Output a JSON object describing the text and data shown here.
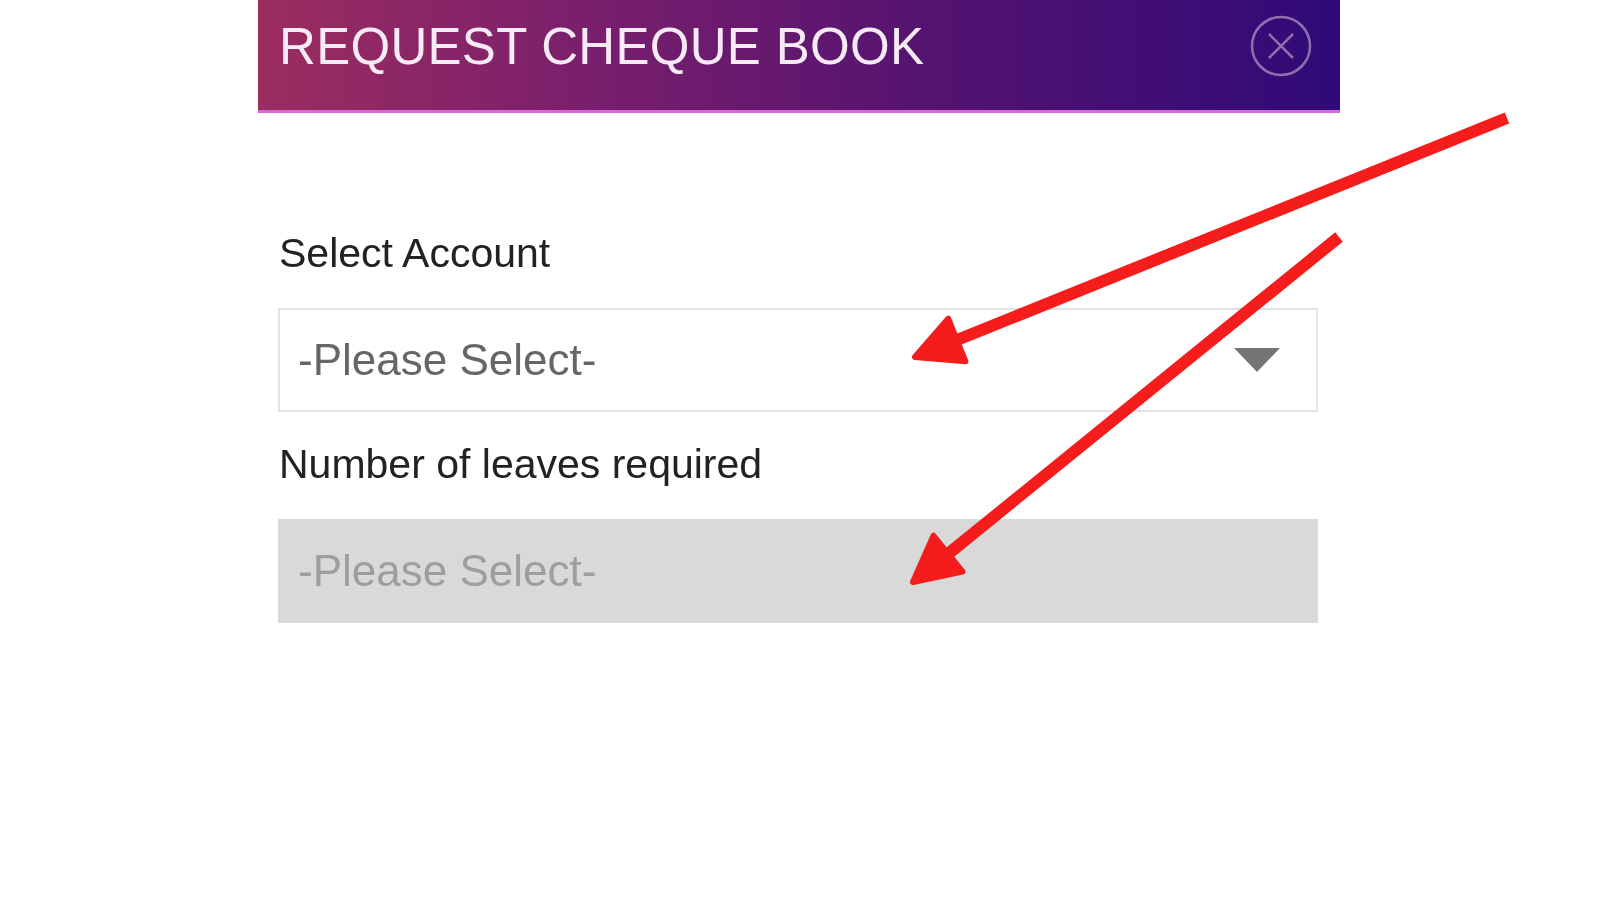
{
  "dialog": {
    "title": "REQUEST CHEQUE BOOK"
  },
  "fields": [
    {
      "label": "Select Account",
      "placeholder": "-Please Select-",
      "disabled": false
    },
    {
      "label": "Number of leaves required",
      "placeholder": "-Please Select-",
      "disabled": true
    }
  ],
  "annotations": [
    {
      "kind": "arrow"
    },
    {
      "kind": "arrow"
    }
  ]
}
